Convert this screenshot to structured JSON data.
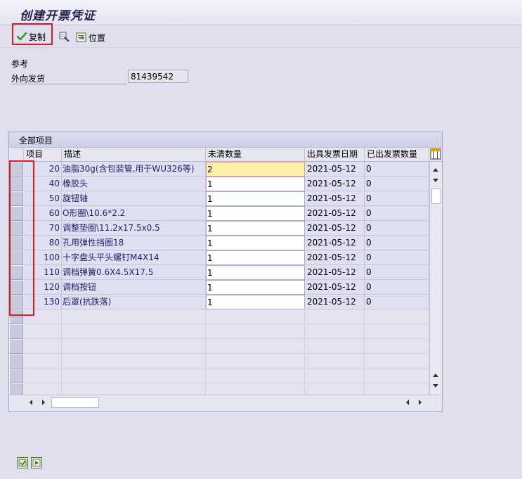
{
  "title": "创建开票凭证",
  "toolbar": {
    "copy_label": "复制",
    "position_label": "位置"
  },
  "reference": {
    "section_label": "参考",
    "outbound_label": "外向发货",
    "outbound_value": "81439542"
  },
  "grid": {
    "caption": "全部项目",
    "columns": [
      "项目",
      "描述",
      "未清数量",
      "出具发票日期",
      "已出发票数量"
    ],
    "rows": [
      {
        "item": "20",
        "desc": "油脂30g(含包装管,用于WU326等)",
        "qty": "2",
        "date": "2021-05-12",
        "invoiced": "0"
      },
      {
        "item": "40",
        "desc": "橡胶头",
        "qty": "1",
        "date": "2021-05-12",
        "invoiced": "0"
      },
      {
        "item": "50",
        "desc": "旋钮轴",
        "qty": "1",
        "date": "2021-05-12",
        "invoiced": "0"
      },
      {
        "item": "60",
        "desc": "O形圈\\10.6*2.2",
        "qty": "1",
        "date": "2021-05-12",
        "invoiced": "0"
      },
      {
        "item": "70",
        "desc": "调整垫圈\\11.2x17.5x0.5",
        "qty": "1",
        "date": "2021-05-12",
        "invoiced": "0"
      },
      {
        "item": "80",
        "desc": "孔用弹性挡圈18",
        "qty": "1",
        "date": "2021-05-12",
        "invoiced": "0"
      },
      {
        "item": "100",
        "desc": "十字盘头平头螺钉M4X14",
        "qty": "1",
        "date": "2021-05-12",
        "invoiced": "0"
      },
      {
        "item": "110",
        "desc": "调档弹簧0.6X4.5X17.5",
        "qty": "1",
        "date": "2021-05-12",
        "invoiced": "0"
      },
      {
        "item": "120",
        "desc": "调档按钮",
        "qty": "1",
        "date": "2021-05-12",
        "invoiced": "0"
      },
      {
        "item": "130",
        "desc": "后罩(抗跌落)",
        "qty": "1",
        "date": "2021-05-12",
        "invoiced": "0"
      }
    ],
    "empty_rows": 6
  },
  "icons": {
    "copy": "checkmark-icon",
    "find": "find-icon",
    "position": "position-icon",
    "settings": "column-settings-icon"
  },
  "colors": {
    "highlight": "#e01b24",
    "active_cell": "#fff0a8",
    "text_blue": "#22226c"
  }
}
